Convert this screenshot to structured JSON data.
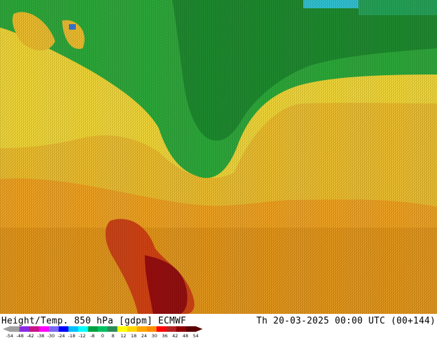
{
  "map": {
    "title_left": "Height/Temp. 850 hPa [gdpm] ECMWF",
    "title_right": "Th 20-03-2025 00:00 UTC (00+144)"
  },
  "legend": {
    "ticks": [
      "-54",
      "-48",
      "-42",
      "-38",
      "-30",
      "-24",
      "-18",
      "-12",
      "-8",
      "0",
      "8",
      "12",
      "18",
      "24",
      "30",
      "36",
      "42",
      "48",
      "54"
    ],
    "colors": [
      "#a0a0a0",
      "#8a2be2",
      "#c71585",
      "#ff00ff",
      "#7b68ee",
      "#0000ff",
      "#00bfff",
      "#00ffff",
      "#00a040",
      "#00c060",
      "#2e8b57",
      "#ffff00",
      "#ffd700",
      "#ffa500",
      "#ff8c00",
      "#ff0000",
      "#b22222",
      "#8b0000",
      "#5a0000"
    ]
  }
}
